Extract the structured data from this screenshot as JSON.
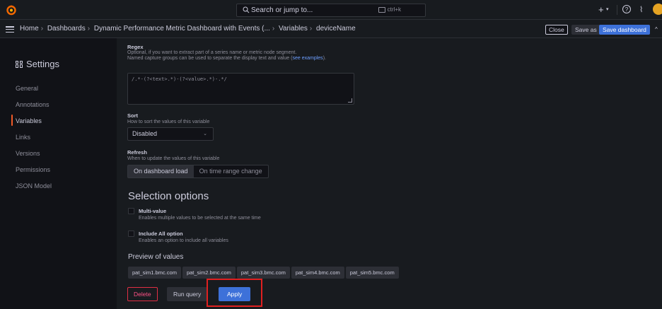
{
  "topbar": {
    "search_placeholder": "Search or jump to...",
    "search_shortcut": "ctrl+k",
    "plus_label": "+"
  },
  "breadcrumbs": {
    "items": [
      "Home",
      "Dashboards",
      "Dynamic Performance Metric Dashboard with Events (...",
      "Variables",
      "deviceName"
    ],
    "close_label": "Close",
    "saveas_label": "Save as",
    "save_label": "Save dashboard"
  },
  "sidebar": {
    "title": "Settings",
    "items": [
      {
        "label": "General"
      },
      {
        "label": "Annotations"
      },
      {
        "label": "Variables"
      },
      {
        "label": "Links"
      },
      {
        "label": "Versions"
      },
      {
        "label": "Permissions"
      },
      {
        "label": "JSON Model"
      }
    ]
  },
  "regex": {
    "label": "Regex",
    "desc1": "Optional, if you want to extract part of a series name or metric node segment.",
    "desc2": "Named capture groups can be used to separate the display text and value (",
    "link": "see examples",
    "desc3": ").",
    "value": "/.*-(?<text>.*)-(?<value>.*)-.*/"
  },
  "sort": {
    "label": "Sort",
    "desc": "How to sort the values of this variable",
    "value": "Disabled"
  },
  "refresh": {
    "label": "Refresh",
    "desc": "When to update the values of this variable",
    "options": [
      "On dashboard load",
      "On time range change"
    ],
    "selected": "On dashboard load"
  },
  "selection": {
    "title": "Selection options",
    "multi_label": "Multi-value",
    "multi_desc": "Enables multiple values to be selected at the same time",
    "all_label": "Include All option",
    "all_desc": "Enables an option to include all variables"
  },
  "preview": {
    "title": "Preview of values",
    "values": [
      "pat_sim1.bmc.com",
      "pat_sim2.bmc.com",
      "pat_sim3.bmc.com",
      "pat_sim4.bmc.com",
      "pat_sim5.bmc.com"
    ]
  },
  "actions": {
    "delete_label": "Delete",
    "run_label": "Run query",
    "apply_label": "Apply"
  },
  "colors": {
    "accent": "#3d71d9",
    "active_nav": "#f05a28",
    "highlight": "#e02020",
    "danger": "#e02f44"
  }
}
